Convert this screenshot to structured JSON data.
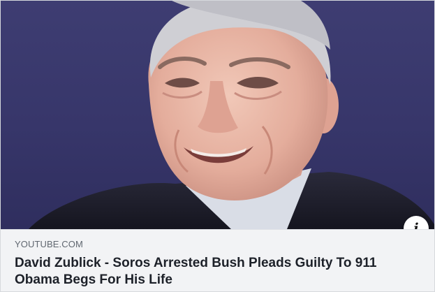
{
  "link_preview": {
    "domain": "YOUTUBE.COM",
    "title_line_1": "David Zublick - Soros Arrested Bush Pleads Guilty To 911",
    "title_line_2": "Obama Begs For His Life",
    "info_icon_glyph": "i",
    "thumbnail_icon": "elderly-man-portrait-photo"
  },
  "colors": {
    "thumbnail_background": "#3e3d72",
    "meta_background": "#f2f3f5",
    "domain_text": "#606770",
    "title_text": "#1d2129"
  }
}
